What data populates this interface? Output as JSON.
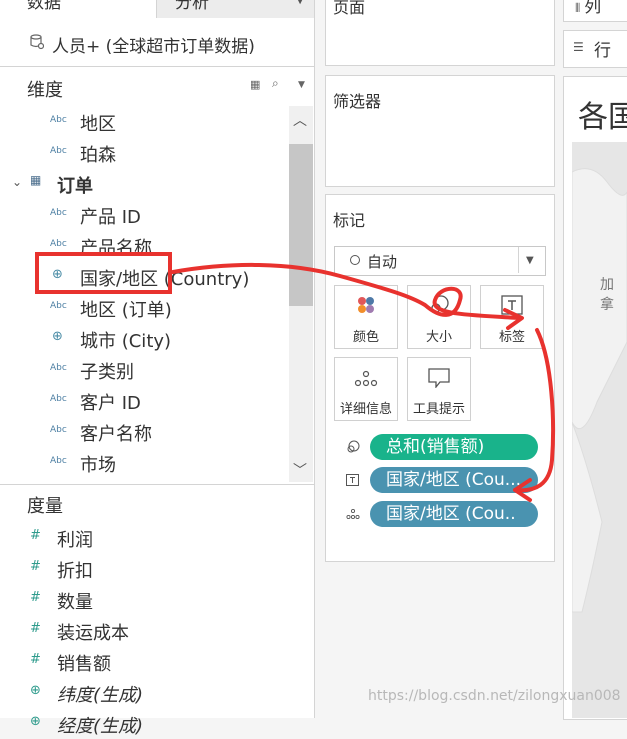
{
  "tabs": {
    "data": "数据",
    "analysis": "分析"
  },
  "datasource": {
    "label": "人员+ (全球超市订单数据)"
  },
  "dimensions": {
    "title": "维度",
    "items": [
      {
        "type": "Abc",
        "label": "地区"
      },
      {
        "type": "Abc",
        "label": "珀森"
      },
      {
        "type": "table",
        "label": "订单",
        "group": true
      },
      {
        "type": "Abc",
        "label": "产品 ID"
      },
      {
        "type": "Abc",
        "label": "产品名称"
      },
      {
        "type": "globe",
        "label": "国家/地区 (Country)"
      },
      {
        "type": "Abc",
        "label": "地区 (订单)"
      },
      {
        "type": "globe",
        "label": "城市 (City)"
      },
      {
        "type": "Abc",
        "label": "子类别"
      },
      {
        "type": "Abc",
        "label": "客户 ID"
      },
      {
        "type": "Abc",
        "label": "客户名称"
      },
      {
        "type": "Abc",
        "label": "市场"
      }
    ]
  },
  "measures": {
    "title": "度量",
    "items": [
      {
        "type": "#",
        "label": "利润"
      },
      {
        "type": "#",
        "label": "折扣"
      },
      {
        "type": "#",
        "label": "数量"
      },
      {
        "type": "#",
        "label": "装运成本"
      },
      {
        "type": "#",
        "label": "销售额"
      },
      {
        "type": "globe",
        "label": "纬度(生成)",
        "italic": true
      },
      {
        "type": "globe",
        "label": "经度(生成)",
        "italic": true
      }
    ]
  },
  "cards": {
    "pages": "页面",
    "filters": "筛选器",
    "marks": "标记"
  },
  "marks": {
    "type": "自动",
    "buttons": {
      "color": "颜色",
      "size": "大小",
      "label": "标签",
      "detail": "详细信息",
      "tooltip": "工具提示"
    },
    "pills": [
      {
        "label": "总和(销售额)",
        "icon": "size-icon",
        "color": "#19b38b"
      },
      {
        "label": "国家/地区 (Cou...",
        "icon": "text-icon",
        "color": "#4a93b0"
      },
      {
        "label": "国家/地区 (Cou..",
        "icon": "detail-icon",
        "color": "#4a93b0"
      }
    ]
  },
  "shelves": {
    "columns": "列",
    "rows": "行"
  },
  "viz": {
    "title": "各国",
    "map_label": "加拿"
  },
  "watermark": "https://blog.csdn.net/zilongxuan008",
  "annotation_color": "#e8322e"
}
